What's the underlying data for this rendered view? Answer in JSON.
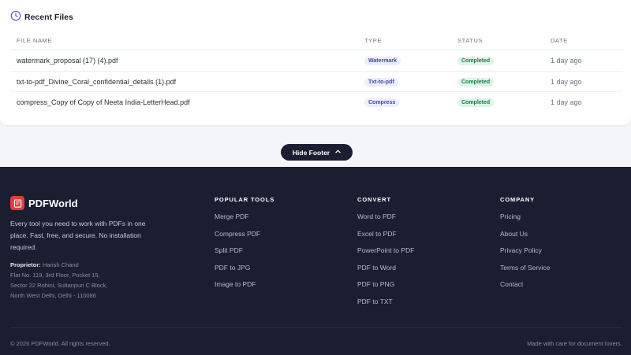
{
  "recent_files": {
    "title": "Recent Files",
    "columns": {
      "name": "FILE NAME",
      "type": "TYPE",
      "status": "STATUS",
      "date": "DATE"
    },
    "rows": [
      {
        "name": "watermark_proposal (17) (4).pdf",
        "type": "Watermark",
        "status": "Completed",
        "date": "1 day ago"
      },
      {
        "name": "txt-to-pdf_Divine_Coral_confidential_details (1).pdf",
        "type": "Txt-to-pdf",
        "status": "Completed",
        "date": "1 day ago"
      },
      {
        "name": "compress_Copy of Copy of Neeta India-LetterHead.pdf",
        "type": "Compress",
        "status": "Completed",
        "date": "1 day ago"
      }
    ]
  },
  "toggle": {
    "label": "Hide Footer"
  },
  "footer": {
    "brand": "PDFWorld",
    "description": "Every tool you need to work with PDFs in one place. Fast, free, and secure. No installation required.",
    "proprietor_label": "Proprietor:",
    "proprietor_name": "Harish Chand",
    "address_lines": [
      "Flat No. 119, 3rd Floor, Pocket 15,",
      "Sector 22 Rohini, Sultanpuri C Block,",
      "North West Delhi, Delhi - 110086"
    ],
    "popular_tools": {
      "heading": "POPULAR TOOLS",
      "links": [
        "Merge PDF",
        "Compress PDF",
        "Split PDF",
        "PDF to JPG",
        "Image to PDF"
      ]
    },
    "convert": {
      "heading": "CONVERT",
      "links": [
        "Word to PDF",
        "Excel to PDF",
        "PowerPoint to PDF",
        "PDF to Word",
        "PDF to PNG",
        "PDF to TXT"
      ]
    },
    "company": {
      "heading": "COMPANY",
      "links": [
        "Pricing",
        "About Us",
        "Privacy Policy",
        "Terms of Service",
        "Contact"
      ]
    },
    "copyright": "© 2026 PDFWorld. All rights reserved.",
    "made_with": "Made with care for document lovers."
  },
  "colors": {
    "accent": "#4045a8",
    "footer_bg": "#1b1d31",
    "brand_red": "#e33c3c",
    "status_green": "#14804a"
  }
}
